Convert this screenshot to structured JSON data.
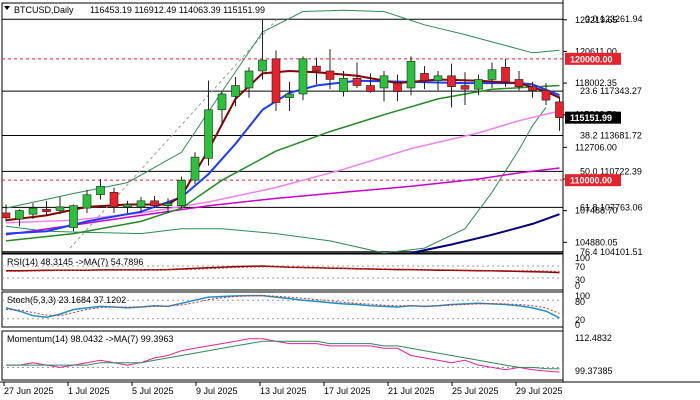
{
  "chart_data": {
    "type": "candlestick",
    "symbol": "BTCUSD,Daily",
    "ohlc_header": "116453.19 116912.49 114063.39 115151.99",
    "x_tick_labels": [
      "27 Jun 2025",
      "1 Jul 2025",
      "5 Jul 2025",
      "9 Jul 2025",
      "13 Jul 2025",
      "17 Jul 2025",
      "21 Jul 2025",
      "25 Jul 2025",
      "29 Jul 2025"
    ],
    "price_axis": {
      "ylim": [
        104000,
        124600
      ],
      "tick_labels": [
        "123219.65",
        "120611.00",
        "118002.35",
        "115393.70",
        "112706.00",
        "110097.35",
        "107488.70",
        "104880.05"
      ]
    },
    "price_badges": [
      {
        "label": "120000.00",
        "value": 120000,
        "color": "#e8212b"
      },
      {
        "label": "115151.99",
        "value": 115152,
        "color": "#000000"
      },
      {
        "label": "110000.00",
        "value": 110000,
        "color": "#e8212b"
      }
    ],
    "fib_levels": [
      {
        "label": "0.0 123261.94",
        "value": 123262
      },
      {
        "label": "23.6 117343.27",
        "value": 117343
      },
      {
        "label": "38.2 113681.72",
        "value": 113682
      },
      {
        "label": "50.0 110722.39",
        "value": 110722
      },
      {
        "label": "61.8 107763.06",
        "value": 107763
      },
      {
        "label": "76.4 104101.51",
        "value": 104102
      }
    ],
    "horizontal_lines": [
      {
        "value": 120000,
        "color": "#e8212b",
        "style": "dashed"
      },
      {
        "value": 110000,
        "color": "#e8212b",
        "style": "dashed"
      }
    ],
    "candles": [
      {
        "o": 107300,
        "h": 108000,
        "l": 106600,
        "c": 106900
      },
      {
        "o": 106800,
        "h": 107600,
        "l": 106200,
        "c": 107500
      },
      {
        "o": 107200,
        "h": 108100,
        "l": 106800,
        "c": 107700
      },
      {
        "o": 107600,
        "h": 108300,
        "l": 107100,
        "c": 107400
      },
      {
        "o": 107500,
        "h": 108600,
        "l": 107200,
        "c": 107800
      },
      {
        "o": 106100,
        "h": 108000,
        "l": 105800,
        "c": 107900
      },
      {
        "o": 107700,
        "h": 109200,
        "l": 107300,
        "c": 108800
      },
      {
        "o": 108800,
        "h": 110100,
        "l": 108400,
        "c": 109500
      },
      {
        "o": 109000,
        "h": 109400,
        "l": 107300,
        "c": 107800
      },
      {
        "o": 107800,
        "h": 108300,
        "l": 107300,
        "c": 108000
      },
      {
        "o": 107800,
        "h": 108600,
        "l": 107300,
        "c": 108300
      },
      {
        "o": 108300,
        "h": 108700,
        "l": 107700,
        "c": 107900
      },
      {
        "o": 107900,
        "h": 108500,
        "l": 107300,
        "c": 108100
      },
      {
        "o": 107900,
        "h": 110300,
        "l": 107700,
        "c": 110000
      },
      {
        "o": 110000,
        "h": 112300,
        "l": 109700,
        "c": 111900
      },
      {
        "o": 111800,
        "h": 118200,
        "l": 111200,
        "c": 115800
      },
      {
        "o": 115800,
        "h": 117300,
        "l": 114700,
        "c": 117100
      },
      {
        "o": 116900,
        "h": 118500,
        "l": 116100,
        "c": 117800
      },
      {
        "o": 117600,
        "h": 119300,
        "l": 116800,
        "c": 119000
      },
      {
        "o": 119000,
        "h": 123200,
        "l": 118300,
        "c": 119900
      },
      {
        "o": 120000,
        "h": 120700,
        "l": 115700,
        "c": 116400
      },
      {
        "o": 116800,
        "h": 118100,
        "l": 115700,
        "c": 117100
      },
      {
        "o": 117100,
        "h": 120200,
        "l": 116600,
        "c": 120000
      },
      {
        "o": 119400,
        "h": 120100,
        "l": 117900,
        "c": 119000
      },
      {
        "o": 119000,
        "h": 120800,
        "l": 117500,
        "c": 118300
      },
      {
        "o": 117300,
        "h": 119000,
        "l": 116900,
        "c": 118400
      },
      {
        "o": 118400,
        "h": 119700,
        "l": 117600,
        "c": 117800
      },
      {
        "o": 117800,
        "h": 118800,
        "l": 117200,
        "c": 117300
      },
      {
        "o": 117600,
        "h": 119000,
        "l": 116500,
        "c": 118600
      },
      {
        "o": 118000,
        "h": 118700,
        "l": 116500,
        "c": 117300
      },
      {
        "o": 117600,
        "h": 120200,
        "l": 117000,
        "c": 119800
      },
      {
        "o": 118800,
        "h": 119400,
        "l": 117500,
        "c": 118200
      },
      {
        "o": 118200,
        "h": 119000,
        "l": 117400,
        "c": 118600
      },
      {
        "o": 118600,
        "h": 119600,
        "l": 116000,
        "c": 117700
      },
      {
        "o": 117800,
        "h": 118900,
        "l": 116200,
        "c": 117500
      },
      {
        "o": 117500,
        "h": 118700,
        "l": 117000,
        "c": 118300
      },
      {
        "o": 118300,
        "h": 119700,
        "l": 117600,
        "c": 119100
      },
      {
        "o": 119300,
        "h": 120000,
        "l": 117700,
        "c": 118100
      },
      {
        "o": 118300,
        "h": 119000,
        "l": 117400,
        "c": 117700
      },
      {
        "o": 117700,
        "h": 118100,
        "l": 116800,
        "c": 117400
      },
      {
        "o": 117400,
        "h": 118000,
        "l": 116200,
        "c": 116600
      },
      {
        "o": 116450,
        "h": 116910,
        "l": 114060,
        "c": 115152
      }
    ],
    "oscillators": [
      {
        "name": "rsi",
        "label": "RSI(14) 48.3145 ->MA(7) 54.7896",
        "tick_labels": [
          "100",
          "70",
          "30",
          "0"
        ]
      },
      {
        "name": "stoch",
        "label": "Stoch(5,3,3) 23.1684 37.1202",
        "tick_labels": [
          "100",
          "80",
          "20",
          "0"
        ]
      },
      {
        "name": "momentum",
        "label": "Momentum(14) 98.0432 ->MA(7) 99.3963",
        "tick_labels": [
          "112.4832",
          "99.37385"
        ]
      }
    ]
  }
}
